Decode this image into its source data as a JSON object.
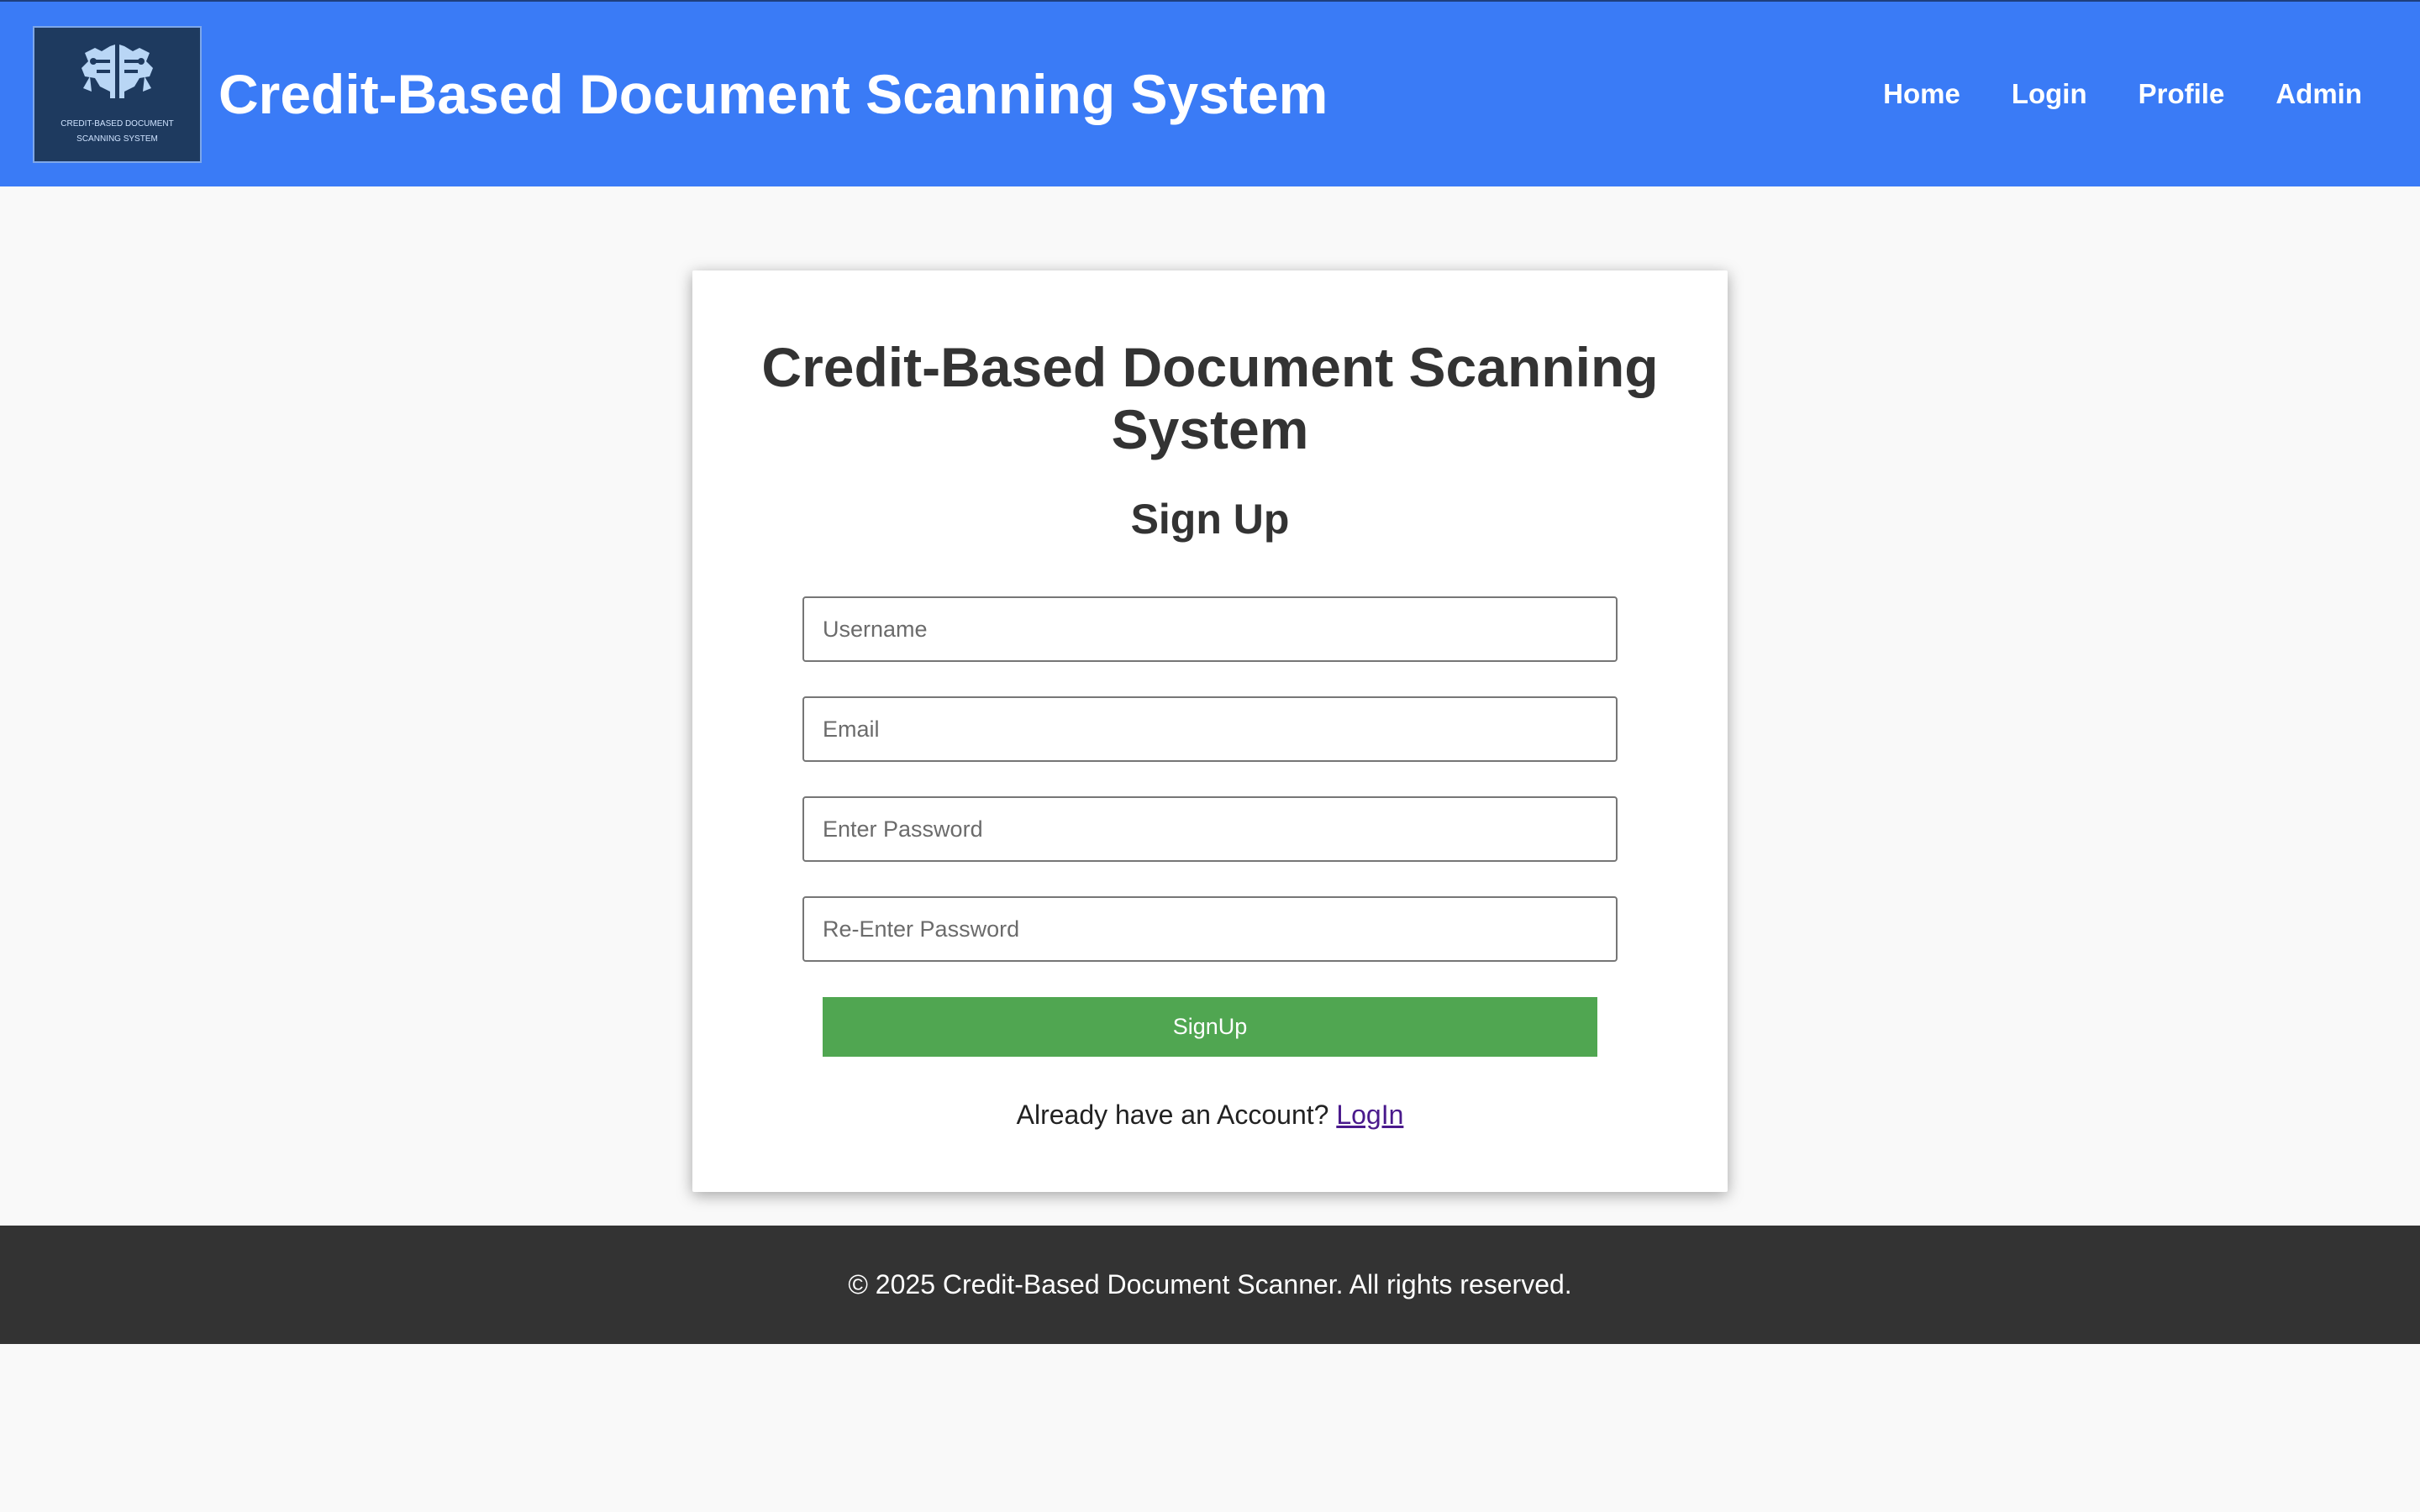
{
  "header": {
    "logo": {
      "icon": "brain-circuit-icon",
      "line1": "CREDIT-BASED DOCUMENT",
      "line2": "SCANNING SYSTEM"
    },
    "title": "Credit-Based Document Scanning System",
    "nav": [
      "Home",
      "Login",
      "Profile",
      "Admin"
    ]
  },
  "card": {
    "title": "Credit-Based Document Scanning System",
    "subtitle": "Sign Up",
    "fields": {
      "username_placeholder": "Username",
      "email_placeholder": "Email",
      "password_placeholder": "Enter Password",
      "repassword_placeholder": "Re-Enter Password"
    },
    "signup_label": "SignUp",
    "account_prompt": "Already have an Account?",
    "login_link": "LogIn"
  },
  "footer": {
    "text": "© 2025 Credit-Based Document Scanner. All rights reserved."
  },
  "colors": {
    "header_bg": "#3a7bf6",
    "button_green": "#50a651",
    "footer_bg": "#333333",
    "link_purple": "#4a1a8c",
    "logo_bg": "#1e3a5f"
  }
}
